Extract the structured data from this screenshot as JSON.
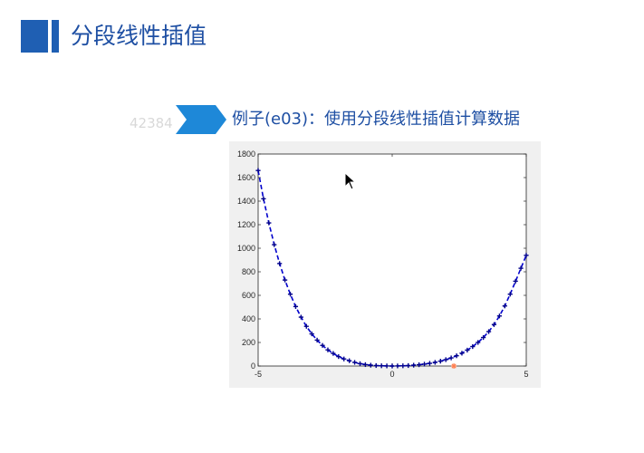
{
  "slide": {
    "title": "分段线性插值",
    "example_text": "例子(e03)：使用分段线性插值计算数据",
    "watermark": "42384",
    "colors": {
      "accent": "#1f5fb3",
      "title_text": "#1e4fa3",
      "line": "#0000cc",
      "marker": "#00008b",
      "highlight": "#ff7f50"
    }
  },
  "chart_data": {
    "type": "line",
    "title": "",
    "xlabel": "",
    "ylabel": "",
    "xlim": [
      -5,
      5
    ],
    "ylim": [
      0,
      1800
    ],
    "x_ticks": [
      -5,
      0,
      5
    ],
    "y_ticks": [
      0,
      200,
      400,
      600,
      800,
      1000,
      1200,
      1400,
      1600,
      1800
    ],
    "grid": false,
    "legend": "none",
    "series": [
      {
        "style": "dashed line with + markers",
        "x": [
          -5,
          -4.8,
          -4.6,
          -4.4,
          -4.2,
          -4,
          -3.8,
          -3.6,
          -3.4,
          -3.2,
          -3,
          -2.8,
          -2.6,
          -2.4,
          -2.2,
          -2,
          -1.8,
          -1.6,
          -1.4,
          -1.2,
          -1,
          -0.8,
          -0.6,
          -0.4,
          -0.2,
          0,
          0.2,
          0.4,
          0.6,
          0.8,
          1,
          1.2,
          1.4,
          1.6,
          1.8,
          2,
          2.2,
          2.4,
          2.6,
          2.8,
          3,
          3.2,
          3.4,
          3.6,
          3.8,
          4,
          4.2,
          4.4,
          4.6,
          4.8,
          5
        ],
        "y": [
          1660,
          1420,
          1215,
          1030,
          870,
          730,
          610,
          505,
          415,
          337,
          273,
          220,
          175,
          137,
          107,
          80,
          60,
          45,
          31,
          20,
          12,
          7,
          4,
          2,
          1,
          0,
          1,
          2,
          4,
          7,
          11,
          16,
          23,
          31,
          41,
          54,
          69,
          87,
          109,
          135,
          165,
          200,
          242,
          292,
          352,
          425,
          510,
          610,
          720,
          830,
          940
        ]
      }
    ],
    "highlight_point": {
      "x": 2.3,
      "y": 0
    }
  }
}
